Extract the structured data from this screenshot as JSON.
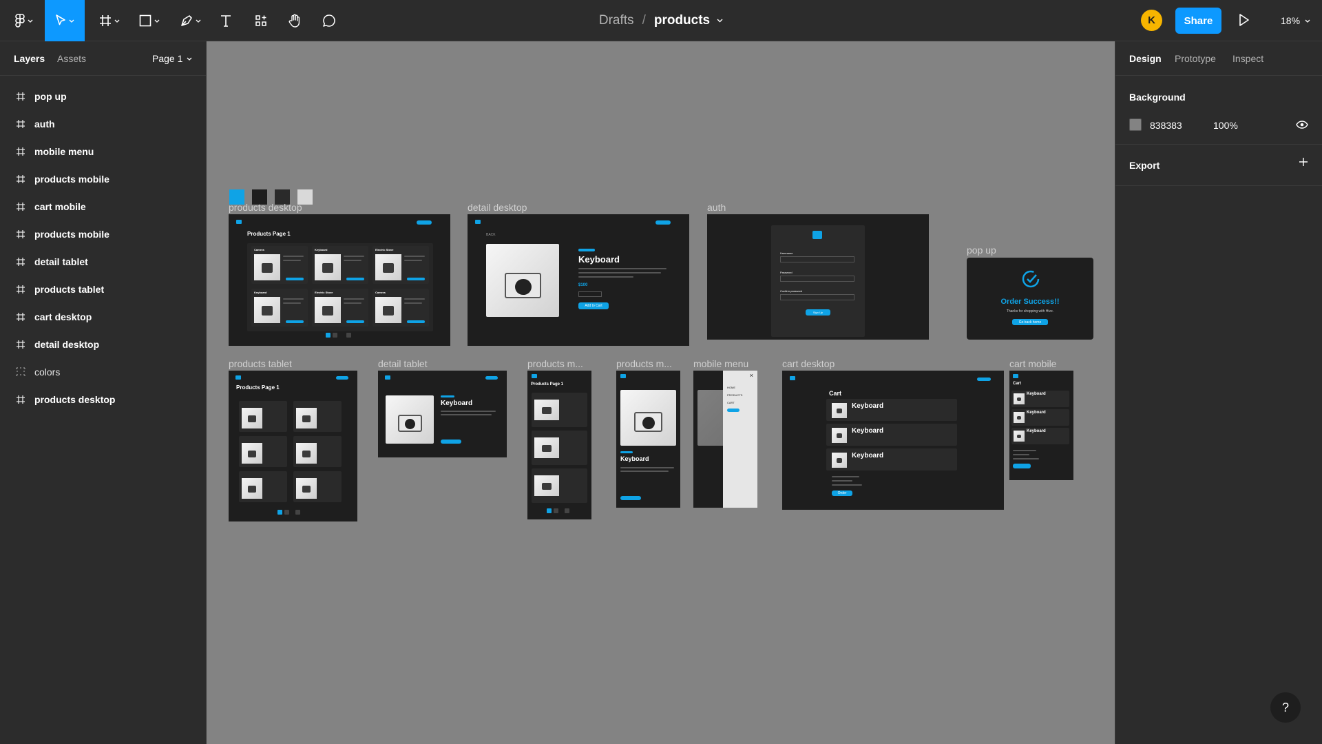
{
  "toolbar": {
    "tools": [
      "main-menu",
      "move",
      "frame",
      "shape",
      "pen",
      "text",
      "resources",
      "hand",
      "comment"
    ],
    "breadcrumb": {
      "folder": "Drafts",
      "separator": "/",
      "file": "products"
    },
    "avatar_initial": "K",
    "share_label": "Share",
    "zoom": "18%"
  },
  "left_panel": {
    "tabs": [
      "Layers",
      "Assets"
    ],
    "page": "Page 1",
    "layers": [
      {
        "name": "pop up",
        "icon": "frame-icon"
      },
      {
        "name": "auth",
        "icon": "frame-icon"
      },
      {
        "name": "mobile menu",
        "icon": "frame-icon"
      },
      {
        "name": "products mobile",
        "icon": "frame-icon"
      },
      {
        "name": "cart mobile",
        "icon": "frame-icon"
      },
      {
        "name": "products mobile",
        "icon": "frame-icon"
      },
      {
        "name": "detail tablet",
        "icon": "frame-icon"
      },
      {
        "name": "products tablet",
        "icon": "frame-icon"
      },
      {
        "name": "cart desktop",
        "icon": "frame-icon"
      },
      {
        "name": "detail desktop",
        "icon": "frame-icon"
      },
      {
        "name": "colors",
        "icon": "grid-icon"
      },
      {
        "name": "products desktop",
        "icon": "frame-icon"
      }
    ]
  },
  "right_panel": {
    "tabs": [
      "Design",
      "Prototype",
      "Inspect"
    ],
    "background": {
      "title": "Background",
      "hex": "838383",
      "opacity": "100%"
    },
    "export": {
      "title": "Export"
    },
    "help": "?"
  },
  "canvas": {
    "background": "#838383",
    "colors": [
      "#0fa3e6",
      "#1e1e1e",
      "#2a2a2a",
      "#d9d9d9"
    ],
    "frames": [
      {
        "label": "products desktop",
        "title": "Products Page 1"
      },
      {
        "label": "detail desktop",
        "title": "Keyboard",
        "price": "$100",
        "back": "BACK",
        "cta": "Add to Cart"
      },
      {
        "label": "auth",
        "fields": [
          "Username",
          "Password",
          "Confirm password"
        ],
        "cta": "Sign Up"
      },
      {
        "label": "pop up",
        "title": "Order Success!!",
        "subtitle": "Thanks for shopping with Hive.",
        "cta": "Go back home"
      },
      {
        "label": "products tablet",
        "title": "Products Page 1"
      },
      {
        "label": "detail tablet",
        "title": "Keyboard"
      },
      {
        "label": "products m...",
        "title": "Products Page 1"
      },
      {
        "label": "products m...",
        "title": "Keyboard"
      },
      {
        "label": "mobile menu",
        "items": [
          "HOME",
          "PRODUCTS",
          "CART"
        ]
      },
      {
        "label": "cart desktop",
        "title": "Cart",
        "items": [
          "Keyboard",
          "Keyboard",
          "Keyboard"
        ],
        "cta": "Order"
      },
      {
        "label": "cart mobile",
        "title": "Cart",
        "items": [
          "Keyboard",
          "Keyboard",
          "Keyboard"
        ]
      }
    ],
    "product_names": [
      "Camera",
      "Keyboard",
      "Electric Stove",
      "Keyboard",
      "Electric Stove",
      "Camera"
    ]
  }
}
